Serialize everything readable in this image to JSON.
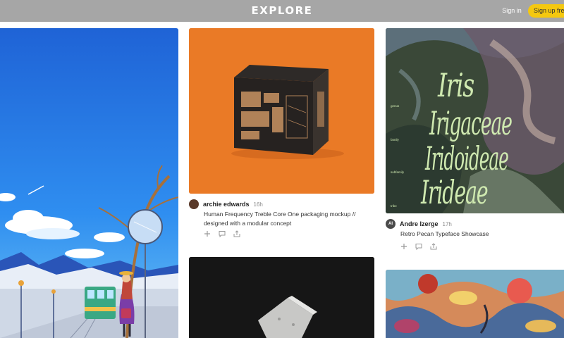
{
  "header": {
    "logo": "EXPLORE",
    "signin": "Sign in",
    "signup": "Sign up free"
  },
  "cards": [
    {
      "author": "archie edwards",
      "time": "16h",
      "title_line1": "Human Frequency Treble Core One packaging mockup //",
      "title_line2": "designed with a modular concept"
    },
    {
      "author": "Andre Izerge",
      "avatar_initials": "AI",
      "time": "17h",
      "title": "Retro Pecan Typeface Showcase"
    }
  ],
  "poster": {
    "words": [
      "Iris",
      "Irigaceae",
      "Iridoideae",
      "Irideae"
    ],
    "ranks": [
      "genus",
      "family",
      "subfamily",
      "tribe"
    ]
  },
  "colors": {
    "header_bg": "#a6a6a6",
    "signup_bg": "#f5c80f",
    "orange_card": "#ea7a26",
    "poster_text": "#cfe9b0"
  },
  "icons": {
    "add": "plus-icon",
    "comment": "comment-icon",
    "share": "share-icon"
  }
}
